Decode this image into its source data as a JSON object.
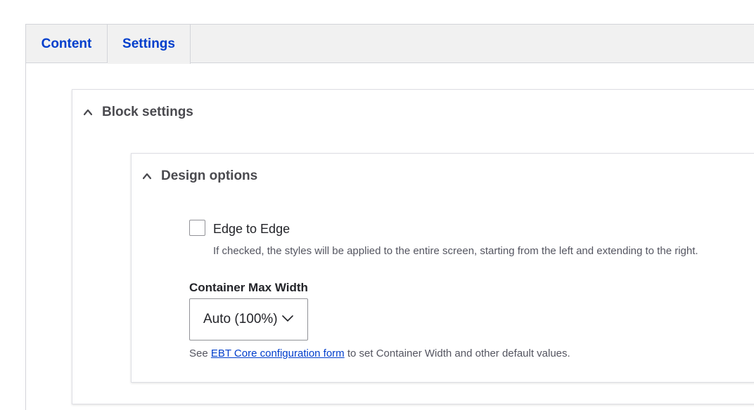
{
  "tabs": [
    {
      "label": "Content",
      "active": false
    },
    {
      "label": "Settings",
      "active": true
    }
  ],
  "block_settings": {
    "title": "Block settings",
    "design_options": {
      "title": "Design options",
      "edge_checkbox": {
        "label": "Edge to Edge",
        "checked": false,
        "description": "If checked, the styles will be applied to the entire screen, starting from the left and extending to the right."
      },
      "container_width": {
        "label": "Container Max Width",
        "selected": "Auto (100%)"
      },
      "help": {
        "prefix": "See ",
        "link_text": "EBT Core configuration form",
        "suffix": " to set Container Width and other default values."
      }
    }
  },
  "colors": {
    "accent": "#003ecc",
    "tab_bg": "#f1f1f1",
    "border": "#d3d4d9"
  }
}
